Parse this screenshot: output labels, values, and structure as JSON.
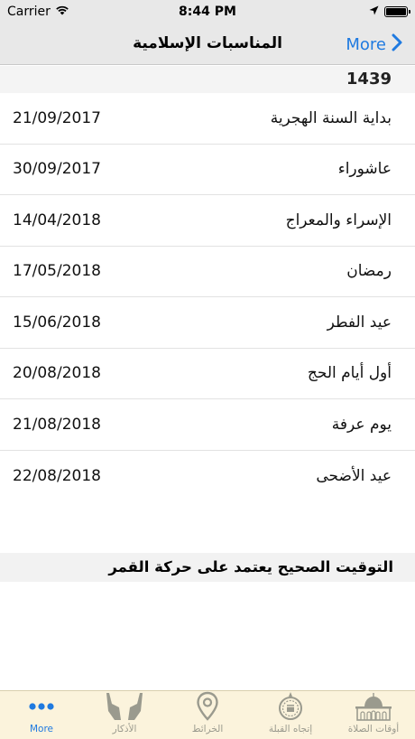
{
  "status_bar": {
    "carrier": "Carrier",
    "time": "8:44 PM"
  },
  "nav": {
    "title": "المناسبات الإسلامية",
    "more_label": "More"
  },
  "year": "1439",
  "events": [
    {
      "name": "بداية السنة الهجرية",
      "date": "21/09/2017"
    },
    {
      "name": "عاشوراء",
      "date": "30/09/2017"
    },
    {
      "name": "الإسراء والمعراج",
      "date": "14/04/2018"
    },
    {
      "name": "رمضان",
      "date": "17/05/2018"
    },
    {
      "name": "عيد الفطر",
      "date": "15/06/2018"
    },
    {
      "name": "أول أيام الحج",
      "date": "20/08/2018"
    },
    {
      "name": "يوم عرفة",
      "date": "21/08/2018"
    },
    {
      "name": "عيد الأضحى",
      "date": "22/08/2018"
    }
  ],
  "note": "التوقيت الصحيح يعتمد على حركة القمر",
  "tabs": [
    {
      "label": "More",
      "icon": "more-dots-icon",
      "active": true
    },
    {
      "label": "الأذكار",
      "icon": "praying-hands-icon",
      "active": false
    },
    {
      "label": "الخرائط",
      "icon": "map-pin-icon",
      "active": false
    },
    {
      "label": "إتجاه القبلة",
      "icon": "qibla-compass-icon",
      "active": false
    },
    {
      "label": "أوقات الصلاة",
      "icon": "mosque-icon",
      "active": false
    }
  ],
  "colors": {
    "accent": "#1f7ae0",
    "tab_bar_bg": "#fbf3dc",
    "nav_bg": "#e8e8e8"
  }
}
